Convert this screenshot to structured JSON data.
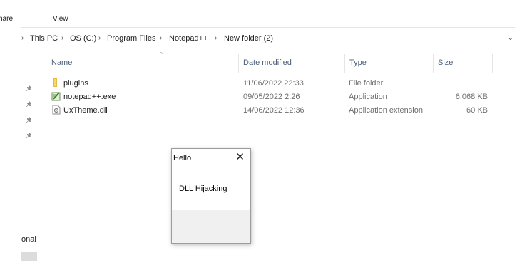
{
  "ribbon": {
    "share_label": "hare",
    "view_label": "View"
  },
  "address": {
    "lead_chevron": "›",
    "crumbs": [
      "This PC",
      "OS (C:)",
      "Program Files",
      "Notepad++",
      "New folder (2)"
    ],
    "separator": "›",
    "dropdown_glyph": "⌄"
  },
  "columns": {
    "name": "Name",
    "date": "Date modified",
    "type": "Type",
    "size": "Size",
    "sort_glyph": "^"
  },
  "files": [
    {
      "name": "plugins",
      "date": "11/06/2022 22:33",
      "type": "File folder",
      "size": "",
      "icon": "folder-icon"
    },
    {
      "name": "notepad++.exe",
      "date": "09/05/2022 2:26",
      "type": "Application",
      "size": "6.068 KB",
      "icon": "notepad-exe-icon"
    },
    {
      "name": "UxTheme.dll",
      "date": "14/06/2022 12:36",
      "type": "Application extension",
      "size": "60 KB",
      "icon": "dll-file-icon"
    }
  ],
  "nav": {
    "pin_glyph": "📌",
    "partial_label": "onal"
  },
  "dialog": {
    "title": "Hello",
    "message": "DLL Hijacking",
    "close_glyph": "✕"
  },
  "colors": {
    "header_text": "#4c607a",
    "folder": "#e8b845",
    "dialog_footer": "#f0f0f0",
    "window_bg": "#ffffff"
  }
}
